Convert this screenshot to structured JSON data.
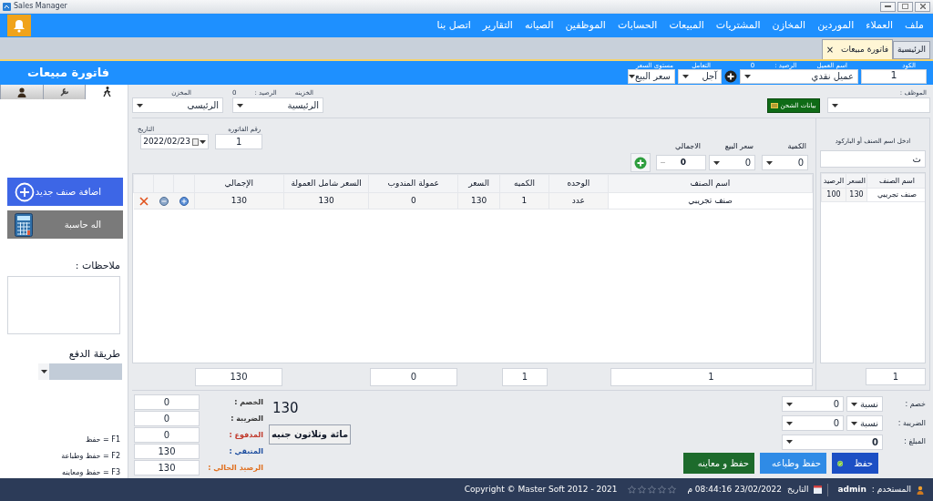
{
  "window": {
    "title": "Sales Manager"
  },
  "menu": [
    "ملف",
    "العملاء",
    "الموردين",
    "المخازن",
    "المشتريات",
    "المبيعات",
    "الحسابات",
    "الموظفين",
    "الصيانه",
    "التقارير",
    "اتصل بنا"
  ],
  "tabs": [
    {
      "label": "الرئيسية",
      "selected": false
    },
    {
      "label": "فاتورة مبيعات",
      "selected": true,
      "close": "×"
    }
  ],
  "header": {
    "title": "فاتورة مبيعات",
    "code_label": "الكود",
    "code": "1",
    "customer_label": "اسم العميل",
    "customer": "عميل نقدي",
    "balance_label": "الرصيد :",
    "balance": "0",
    "dealing_label": "التعامل",
    "dealing": "آجل",
    "price_level_label": "مستوى السعر",
    "price_level": "سعر البيع"
  },
  "store_row": {
    "employee_label": "الموظف :",
    "shipping_button": "بيانات الشحن",
    "treasury_label": "الخزينه",
    "treasury_balance_label": "الرصيد :",
    "treasury_balance": "0",
    "treasury": "الرئيسية",
    "store_label": "المخزن",
    "store": "الرئيسى"
  },
  "invoice": {
    "number_label": "رقم الفاتوره",
    "number": "1",
    "date_label": "التاريخ",
    "date": "2022/02/23"
  },
  "entry": [
    {
      "label": "الكمية",
      "value": "0"
    },
    {
      "label": "سعر البيع",
      "value": "0"
    },
    {
      "label": "الاجمالي",
      "value": "0"
    }
  ],
  "table": {
    "columns": [
      "اسم الصنف",
      "الوحده",
      "الكميه",
      "السعر",
      "عمولة المندوب",
      "السعر شامل العمولة",
      "الإجمالي"
    ],
    "rows": [
      {
        "cells": [
          "صنف تجريبي",
          "عدد",
          "1",
          "130",
          "0",
          "130",
          "130"
        ]
      }
    ],
    "totals": {
      "item_count": "1",
      "quantity": "1",
      "commission": "0",
      "total": "130"
    }
  },
  "items_panel": {
    "search_label": "ادخل اسم الصنف أو الباركود",
    "search_value": "ث",
    "columns": [
      "اسم الصنف",
      "السعر",
      "الرصيد"
    ],
    "rows": [
      [
        "صنف تجريبي",
        "130",
        "100"
      ]
    ],
    "count": "1"
  },
  "side_panel": {
    "tabs": [
      {
        "kind": "walker",
        "selected": true
      },
      {
        "kind": "tools",
        "selected": false
      },
      {
        "kind": "user",
        "selected": false
      }
    ],
    "buttons": [
      {
        "label": "اضافة صنف جديد",
        "kind": "add"
      },
      {
        "label": "اله حاسبة",
        "kind": "calculator"
      }
    ],
    "notes_label": "ملاحظات :",
    "payment_label": "طريقة الدفع",
    "shortcuts": [
      "F1 = حفظ",
      "F2 = حفظ وطباعة",
      "F3 = حفظ ومعاينه"
    ]
  },
  "summary": {
    "amount": "130",
    "amount_words": "مائة وثلاثون جنيه",
    "fields": [
      {
        "label": "الخصم :",
        "value": "0",
        "color": "#333333"
      },
      {
        "label": "الضريبة :",
        "value": "0",
        "color": "#333333"
      },
      {
        "label": "المدفوع :",
        "value": "0",
        "color": "#c0392b"
      },
      {
        "label": "المتبقي :",
        "value": "130",
        "color": "#1f4fa0"
      },
      {
        "label": "الرصيد الحالي :",
        "value": "130",
        "color": "#e07020"
      }
    ]
  },
  "adjustments": [
    {
      "label": "خصم :",
      "type": "نسبة",
      "value": "0"
    },
    {
      "label": "الضريبة :",
      "type": "نسبة",
      "value": "0"
    }
  ],
  "amount_label": "المبلغ :",
  "amount_value": "0",
  "actions": [
    {
      "label": "حفظ",
      "kind": "save"
    },
    {
      "label": "حفظ وطباعه",
      "kind": "print"
    },
    {
      "label": "حفظ و معاينه",
      "kind": "preview"
    }
  ],
  "status_bar": {
    "user_label": "المستخدم :",
    "user": "admin",
    "date_label": "التاريخ",
    "datetime": "23/02/2022 08:44:16 م",
    "stars": 0,
    "copyright": "Copyright © Master Soft 2012 - 2021"
  }
}
